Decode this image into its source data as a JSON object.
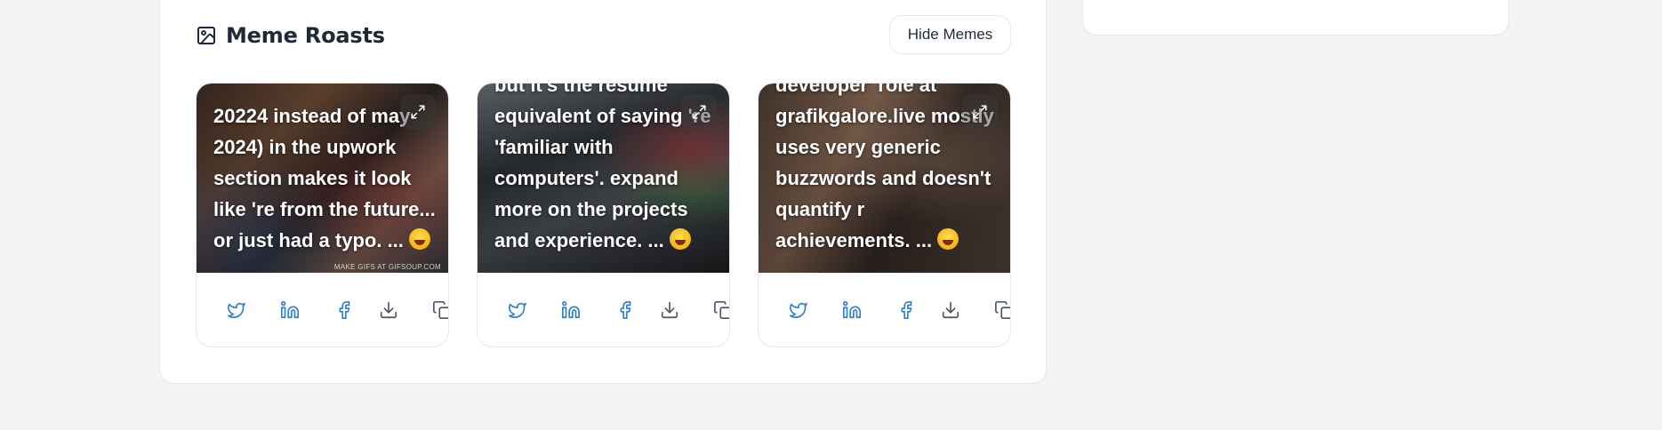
{
  "section": {
    "title": "Meme Roasts",
    "icon": "image-icon"
  },
  "toolbar": {
    "hide_label": "Hide Memes"
  },
  "colors": {
    "share_blue": "#2f7fd0",
    "muted_icon": "#4b5563"
  },
  "memes": [
    {
      "caption": "20224 instead of may 2024) in the upwork section makes it look like 're from the future... or just had a typo. ...",
      "watermark": "MAKE GIFS AT GIFSOUP.COM"
    },
    {
      "caption": "but it's the resume equivalent of saying 're 'familiar with computers'. expand more on the projects and experience. ...",
      "watermark": ""
    },
    {
      "caption": "developer' role at grafikgalore.live mostly uses very generic buzzwords and doesn't quantify r achievements. ...",
      "watermark": ""
    }
  ],
  "actions": [
    {
      "icon": "twitter-icon"
    },
    {
      "icon": "linkedin-icon"
    },
    {
      "icon": "facebook-icon"
    },
    {
      "icon": "download-icon"
    },
    {
      "icon": "copy-icon"
    }
  ]
}
